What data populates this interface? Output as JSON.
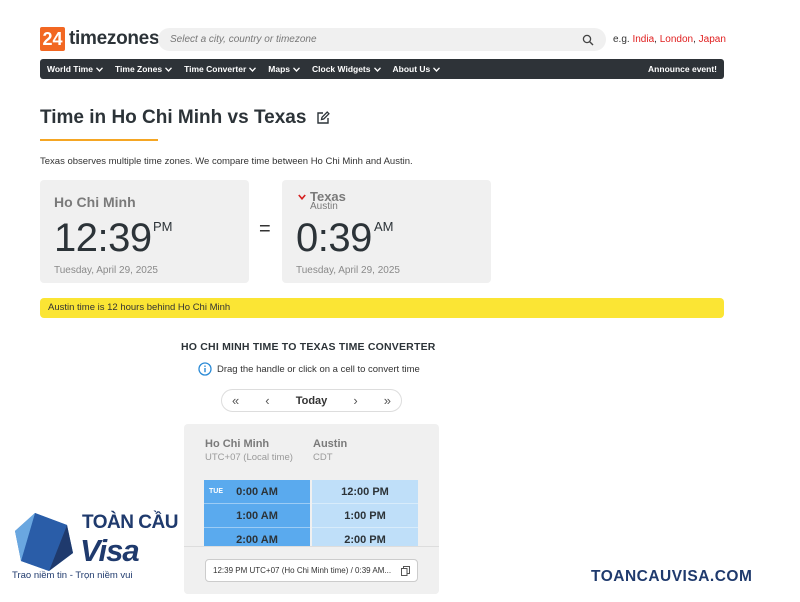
{
  "header": {
    "logo_number": "24",
    "logo_text": "timezones",
    "search_placeholder": "Select a city, country or timezone",
    "eg_label": "e.g.",
    "eg_links": [
      "India",
      "London",
      "Japan"
    ]
  },
  "nav": {
    "items": [
      "World Time",
      "Time Zones",
      "Time Converter",
      "Maps",
      "Clock Widgets",
      "About Us"
    ],
    "announce": "Announce event!"
  },
  "page": {
    "title": "Time in Ho Chi Minh vs Texas",
    "description": "Texas observes multiple time zones. We compare time between Ho Chi Minh and Austin."
  },
  "cards": {
    "hcm": {
      "city": "Ho Chi Minh",
      "time": "12:39",
      "ampm": "PM",
      "date": "Tuesday, April 29, 2025"
    },
    "tx": {
      "city": "Texas",
      "subcity": "Austin",
      "time": "0:39",
      "ampm": "AM",
      "date": "Tuesday, April 29, 2025"
    },
    "equals": "="
  },
  "info_bar": "Austin time is 12 hours behind Ho Chi Minh",
  "converter": {
    "title": "HO CHI MINH TIME TO TEXAS TIME CONVERTER",
    "hint": "Drag the handle or click on a cell to convert time",
    "pager": {
      "first": "«",
      "prev": "‹",
      "today": "Today",
      "next": "›",
      "last": "»"
    },
    "col1": {
      "name": "Ho Chi Minh",
      "tz": "UTC+07 (Local time)",
      "day_tag": "TUE",
      "cells": [
        "0:00 AM",
        "1:00 AM",
        "2:00 AM"
      ]
    },
    "col2": {
      "name": "Austin",
      "tz": "CDT",
      "cells": [
        "12:00 PM",
        "1:00 PM",
        "2:00 PM"
      ]
    },
    "result": "12:39 PM UTC+07 (Ho Chi Minh time) / 0:39 AM..."
  },
  "watermark": {
    "brand_top": "TOÀN CẦU",
    "brand_bottom": "Visa",
    "tagline": "Trao niềm tin - Trọn niềm vui",
    "url": "TOANCAUVISA.COM"
  },
  "colors": {
    "logo_orange": "#f26722",
    "nav_bg": "#2e3338",
    "highlight_yellow": "#fbe534",
    "hcm_cell_blue": "#5aaaee",
    "tx_cell_blue": "#bfdff9",
    "link_red": "#e02020",
    "brand_navy": "#1f3a6d"
  }
}
